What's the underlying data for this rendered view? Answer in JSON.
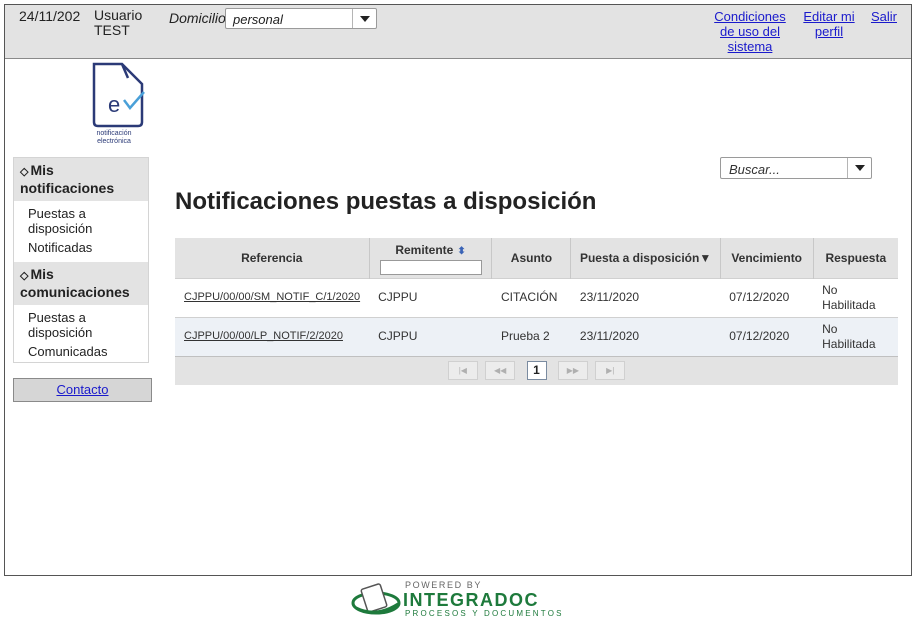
{
  "header": {
    "date": "24/11/202",
    "user_line1": "Usuario",
    "user_line2": "TEST",
    "domicilio_label": "Domicilio",
    "domicilio_value": "personal",
    "links": {
      "conditions": "Condiciones de uso del sistema",
      "edit_profile": "Editar mi perfil",
      "logout": "Salir"
    }
  },
  "logo": {
    "line1": "notificación",
    "line2": "electrónica"
  },
  "sidebar": {
    "notifications_title": "Mis notificaciones",
    "notifications_items": [
      "Puestas a disposición",
      "Notificadas"
    ],
    "communications_title": "Mis comunicaciones",
    "communications_items": [
      "Puestas a disposición",
      "Comunicadas"
    ],
    "contact": "Contacto"
  },
  "search": {
    "placeholder": "Buscar..."
  },
  "main": {
    "title": "Notificaciones puestas a disposición"
  },
  "table": {
    "headers": {
      "reference": "Referencia",
      "sender": "Remitente",
      "subject": "Asunto",
      "available": "Puesta a disposición▼",
      "expiry": "Vencimiento",
      "response": "Respuesta"
    },
    "rows": [
      {
        "reference": "CJPPU/00/00/SM_NOTIF_C/1/2020",
        "sender": "CJPPU",
        "subject": "CITACIÓN",
        "available": "23/11/2020",
        "expiry": "07/12/2020",
        "response": "No Habilitada"
      },
      {
        "reference": "CJPPU/00/00/LP_NOTIF/2/2020",
        "sender": "CJPPU",
        "subject": "Prueba 2",
        "available": "23/11/2020",
        "expiry": "07/12/2020",
        "response": "No Habilitada"
      }
    ],
    "pager": {
      "first": "|◀",
      "prev": "◀◀",
      "current": "1",
      "next": "▶▶",
      "last": "▶|"
    }
  },
  "footer": {
    "powered": "POWERED BY",
    "brand": "INTEGRADOC",
    "tagline": "PROCESOS Y DOCUMENTOS"
  },
  "colors": {
    "brand_green": "#1e7a3c",
    "link_blue": "#1a1acc",
    "header_gray": "#e3e3e3"
  }
}
